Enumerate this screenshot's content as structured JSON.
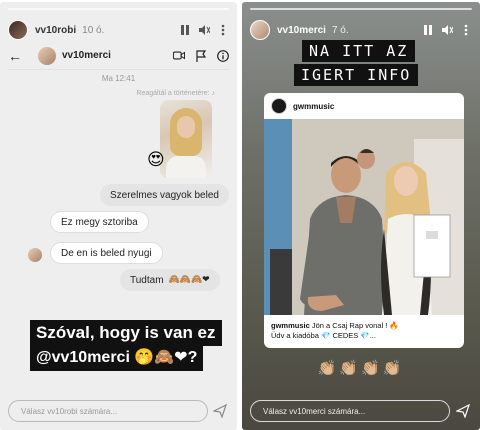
{
  "left_story": {
    "username": "vv10robi",
    "time_ago": "10 ó.",
    "dm": {
      "back_glyph": "←",
      "contact_name": "vv10merci",
      "timestamp": "Ma 12:41",
      "reaction_note": "Reagáltál a történetére: ♪",
      "reaction_emoji": "😍",
      "messages": [
        {
          "text": "Szerelmes vagyok beled",
          "side": "out"
        },
        {
          "text": "Ez megy sztoriba",
          "side": "in"
        },
        {
          "text": "De en is beled nyugi",
          "side": "in"
        },
        {
          "text": "Tudtam",
          "emojis": "🙈🙈🙈❤",
          "side": "out"
        }
      ]
    },
    "caption_lines": [
      "Szóval, hogy is van ez",
      "@vv10merci 🤭🙈❤?"
    ],
    "reply_placeholder": "Válasz vv10robi számára..."
  },
  "right_story": {
    "username": "vv10merci",
    "time_ago": "7 ó.",
    "sticker_lines": [
      "NA ITT AZ",
      "IGERT INFO"
    ],
    "post": {
      "username": "gwmmusic",
      "caption_user": "gwmmusic",
      "caption_text": "Jön a Csaj Rap vonal ! 🔥",
      "caption_line2": "Üdv a kiadóba 💎 CEDES 💎..."
    },
    "claps": "👏🏼👏🏼👏🏼👏🏼",
    "reply_placeholder": "Válasz vv10merci számára..."
  },
  "icons": {
    "pause": "pause-icon",
    "mute": "speaker-icon",
    "more": "more-icon",
    "send": "send-icon",
    "video": "video-icon",
    "flag": "flag-icon",
    "info": "info-icon"
  }
}
